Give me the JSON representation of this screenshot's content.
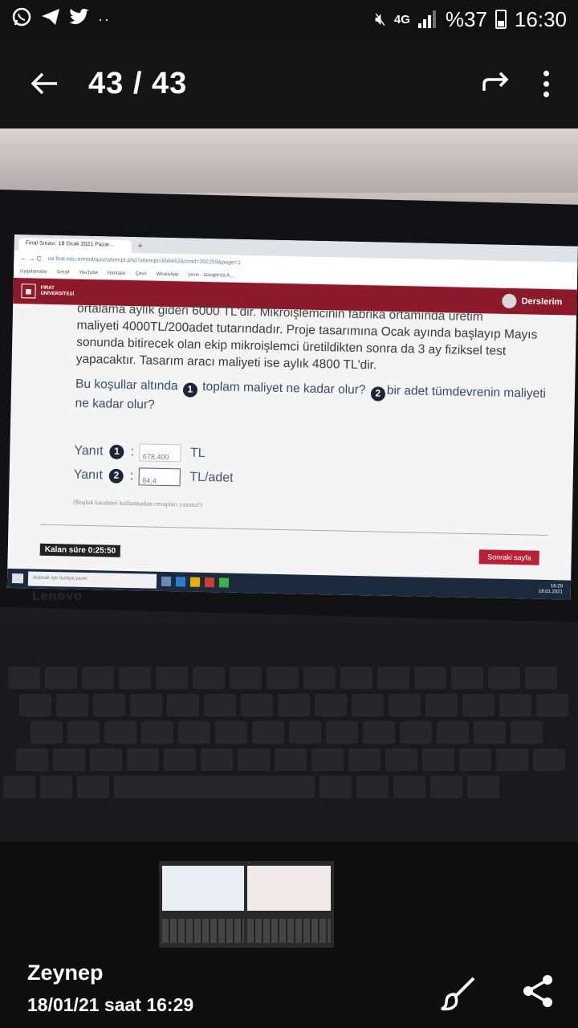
{
  "status_bar": {
    "network": "4G",
    "battery": "%37",
    "time": "16:30"
  },
  "app_bar": {
    "counter": "43 / 43"
  },
  "photo": {
    "browser": {
      "tab_title": "Final Sınavı: 18 Ocak 2021 Pazar...",
      "url": "ue.firat.edu.tr/mod/quiz/attempt.php?attempt=656462&cmid=392259&page=1",
      "bookmarks": [
        "Uygulamalar",
        "Gmail",
        "YouTube",
        "Haritalar",
        "Çevir",
        "WhatsApp",
        "çevin - Google'da A..."
      ]
    },
    "site": {
      "logo_line1": "FIRAT",
      "logo_line2": "ÜNİVERSİTESİ",
      "courses": "Derslerim"
    },
    "question": {
      "cut_line": "ortalama aylık gideri 6000 TL'dir. Mikroişlemcinin fabrika ortamında üretim",
      "text": "maliyeti 4000TL/200adet tutarındadır. Proje tasarımına Ocak ayında başlayıp Mayıs sonunda bitirecek olan ekip mikroişlemci üretildikten sonra da 3 ay fiziksel test yapacaktır. Tasarım aracı maliyeti ise aylık 4800 TL'dir.",
      "ask_prefix": "Bu koşullar altında",
      "ask_one": "toplam maliyet ne kadar olur?",
      "ask_two": "bir adet tümdevrenin maliyeti ne kadar olur?"
    },
    "answers": [
      {
        "label": "Yanıt",
        "num": "1",
        "value": "678,400",
        "unit": "TL"
      },
      {
        "label": "Yanıt",
        "num": "2",
        "value": "84,4",
        "unit": "TL/adet"
      }
    ],
    "note": "(Boşluk karakteri kullanmadan cevapları yazınız!)",
    "timer": "Kalan süre 0:25:50",
    "next_button": "Sonraki sayfa",
    "taskbar_search": "Aramak için buraya yazın",
    "taskbar_time": "16:29",
    "taskbar_date": "18.01.2021",
    "laptop_brand": "Lenovo"
  },
  "info": {
    "author": "Zeynep",
    "datetime": "18/01/21 saat 16:29"
  }
}
